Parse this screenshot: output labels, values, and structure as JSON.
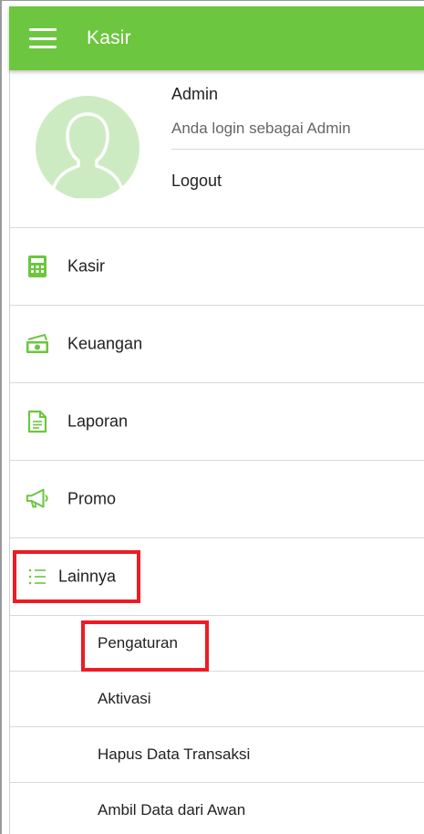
{
  "app": {
    "title": "Kasir",
    "accent_color": "#6cc63f",
    "highlight_color": "#ee1b24"
  },
  "profile": {
    "name": "Admin",
    "subtitle": "Anda login sebagai Admin",
    "logout_label": "Logout",
    "avatar_icon": "person-silhouette-icon"
  },
  "menu": {
    "items": [
      {
        "label": "Kasir",
        "icon": "calculator-icon"
      },
      {
        "label": "Keuangan",
        "icon": "money-icon"
      },
      {
        "label": "Laporan",
        "icon": "document-icon"
      },
      {
        "label": "Promo",
        "icon": "megaphone-icon"
      },
      {
        "label": "Lainnya",
        "icon": "list-icon"
      }
    ],
    "submenu": [
      {
        "label": "Pengaturan"
      },
      {
        "label": "Aktivasi"
      },
      {
        "label": "Hapus Data Transaksi"
      },
      {
        "label": "Ambil Data dari Awan"
      }
    ]
  }
}
